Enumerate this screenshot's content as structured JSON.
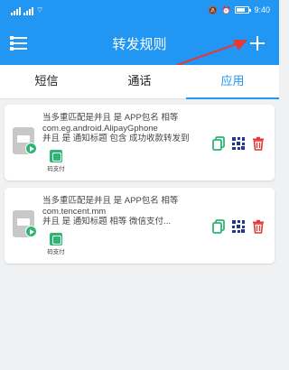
{
  "status_bar": {
    "time": "9:40"
  },
  "app_bar": {
    "title": "转发规则"
  },
  "tabs": [
    {
      "label": "短信",
      "active": false
    },
    {
      "label": "通话",
      "active": false
    },
    {
      "label": "应用",
      "active": true
    }
  ],
  "rules": [
    {
      "line1": "当多重匹配是并且 是 APP包名 相等",
      "line2": "com.eg.android.AlipayGphone",
      "line3": "并且 是 通知标题 包含 成功收款转发到",
      "channel_label": "码支付"
    },
    {
      "line1": "当多重匹配是并且 是 APP包名 相等",
      "line2": "com.tencent.mm",
      "line3": "并且 是 通知标题 相等 微信支付...",
      "channel_label": "码支付"
    }
  ],
  "colors": {
    "primary": "#2196f3",
    "accent_green": "#2bb673",
    "delete_red": "#e53935",
    "annotation_arrow": "#e53935"
  },
  "icons": {
    "menu": "menu-icon",
    "add": "add-icon",
    "copy": "copy-icon",
    "qr": "qr-code-icon",
    "delete": "trash-icon",
    "app": "app-icon",
    "play": "play-icon",
    "channel": "payment-channel-icon"
  }
}
